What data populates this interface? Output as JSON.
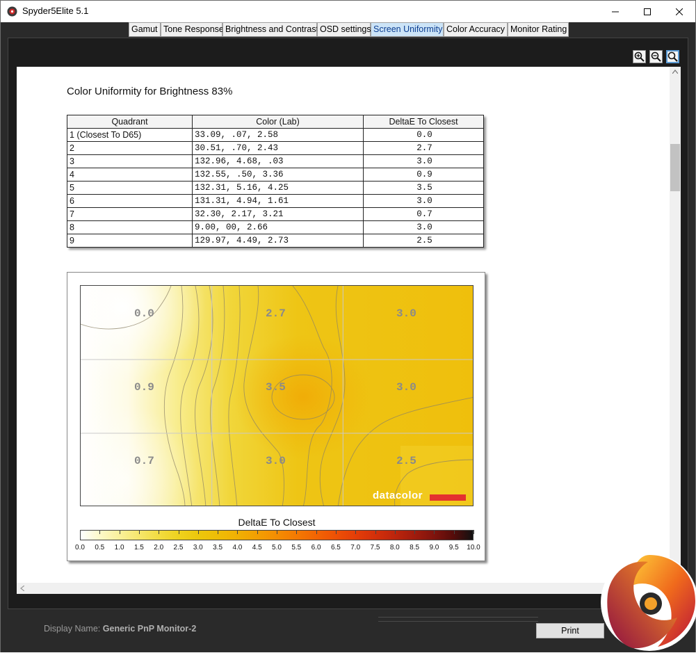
{
  "window": {
    "title": "Spyder5Elite 5.1"
  },
  "tabs": [
    {
      "label": "Gamut"
    },
    {
      "label": "Tone Response"
    },
    {
      "label": "Brightness and Contrast"
    },
    {
      "label": "OSD settings"
    },
    {
      "label": "Screen Uniformity",
      "active": true
    },
    {
      "label": "Color Accuracy"
    },
    {
      "label": "Monitor Rating"
    }
  ],
  "report": {
    "title": "Color Uniformity for Brightness 83%",
    "table": {
      "headers": [
        "Quadrant",
        "Color (Lab)",
        "DeltaE To Closest"
      ],
      "rows": [
        {
          "quadrant": "1 (Closest To D65)",
          "lab": "33.09,      .07,    2.58",
          "deltae": "0.0"
        },
        {
          "quadrant": "2",
          "lab": "30.51,      .70,    2.43",
          "deltae": "2.7"
        },
        {
          "quadrant": "3",
          "lab": "132.96,   4.68,      .03",
          "deltae": "3.0"
        },
        {
          "quadrant": "4",
          "lab": "132.55,     .50,    3.36",
          "deltae": "0.9"
        },
        {
          "quadrant": "5",
          "lab": "132.31,   5.16,    4.25",
          "deltae": "3.5"
        },
        {
          "quadrant": "6",
          "lab": "131.31,   4.94,    1.61",
          "deltae": "3.0"
        },
        {
          "quadrant": "7",
          "lab": "32.30,    2.17,    3.21",
          "deltae": "0.7"
        },
        {
          "quadrant": "8",
          "lab": "9.00,      00,    2.66",
          "deltae": "3.0"
        },
        {
          "quadrant": "9",
          "lab": "129.97,   4.49,    2.73",
          "deltae": "2.5"
        }
      ]
    },
    "heatmap": {
      "cells": [
        "0.0",
        "2.7",
        "3.0",
        "0.9",
        "3.5",
        "3.0",
        "0.7",
        "3.0",
        "2.5"
      ],
      "brand": "datacolor",
      "legend_title": "DeltaE To Closest",
      "scale_ticks": [
        "0.0",
        "0.5",
        "1.0",
        "1.5",
        "2.0",
        "2.5",
        "3.0",
        "3.5",
        "4.0",
        "4.5",
        "5.0",
        "5.5",
        "6.0",
        "6.5",
        "7.0",
        "7.5",
        "8.0",
        "8.5",
        "9.0",
        "9.5",
        "10.0"
      ],
      "scale_colors": [
        "#ffffff",
        "#fdf8c8",
        "#faf09a",
        "#f6e66b",
        "#f2dc40",
        "#eed21e",
        "#ecc70c",
        "#efbd06",
        "#f0b003",
        "#f39f02",
        "#f48d02",
        "#f47a02",
        "#f26503",
        "#ee5105",
        "#e43e08",
        "#d4300a",
        "#bd250c",
        "#a11c0d",
        "#80140d",
        "#560c0a",
        "#111111"
      ]
    }
  },
  "footer": {
    "display_label": "Display Name:",
    "display_value": "Generic PnP Monitor-2",
    "print_label": "Print"
  }
}
